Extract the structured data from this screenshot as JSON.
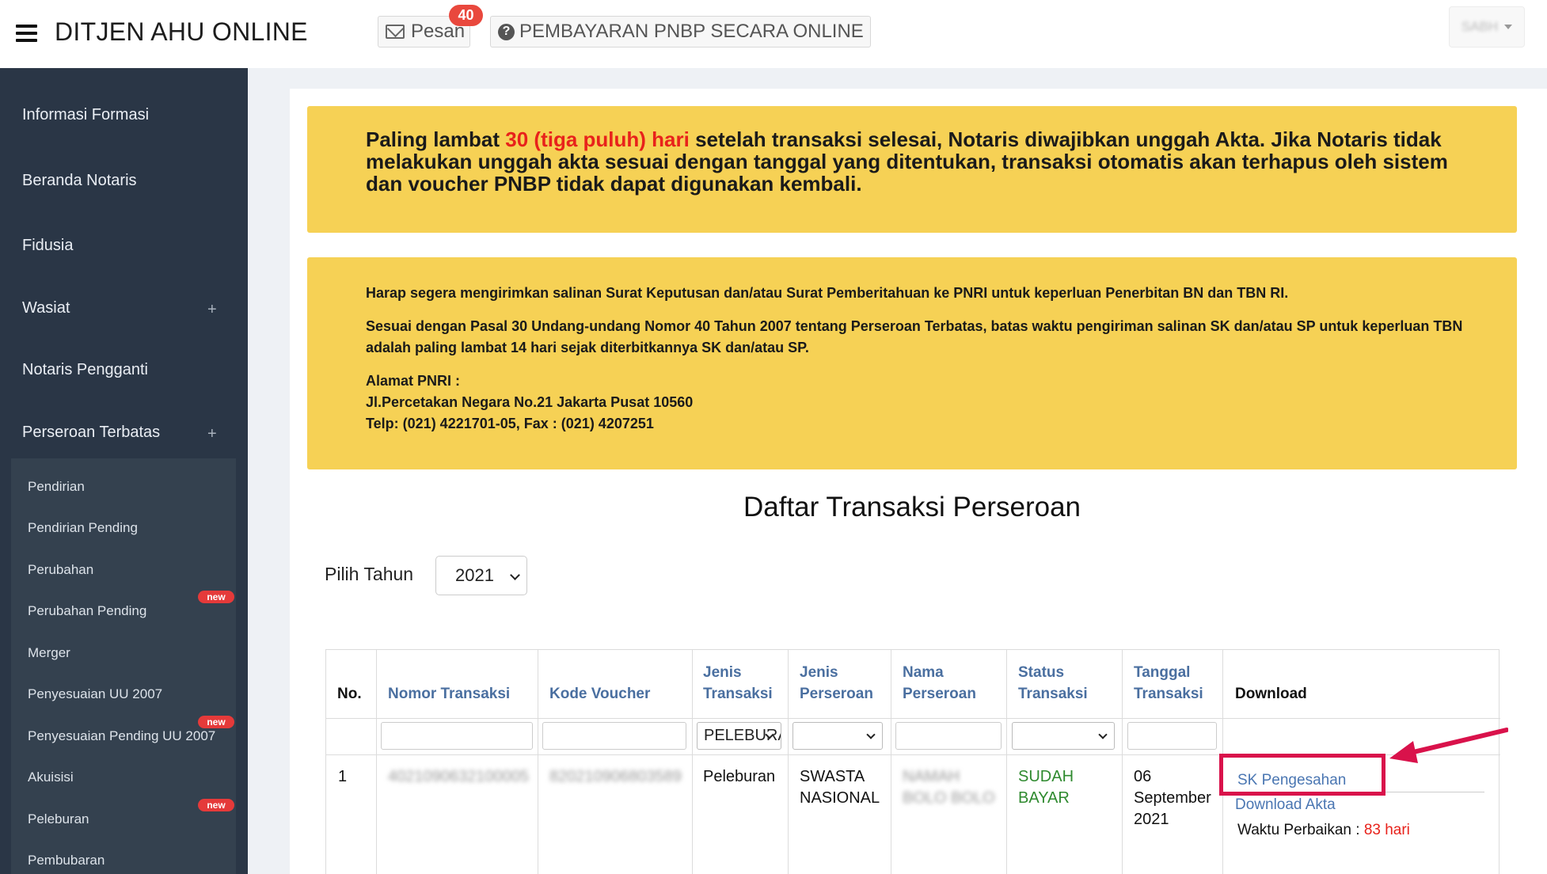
{
  "header": {
    "title": "DITJEN AHU ONLINE",
    "pesan_label": "Pesan",
    "pesan_count": "40",
    "pnbp_label": "PEMBAYARAN PNBP SECARA ONLINE",
    "user_label": "SABH"
  },
  "sidebar": {
    "items": [
      {
        "label": "Informasi Formasi"
      },
      {
        "label": "Beranda Notaris"
      },
      {
        "label": "Fidusia"
      },
      {
        "label": "Wasiat",
        "expand": "+"
      },
      {
        "label": "Notaris Pengganti"
      },
      {
        "label": "Perseroan Terbatas",
        "expand": "+"
      }
    ],
    "submenu": [
      {
        "label": "Pendirian"
      },
      {
        "label": "Pendirian Pending"
      },
      {
        "label": "Perubahan"
      },
      {
        "label": "Perubahan Pending",
        "badge": "new"
      },
      {
        "label": "Merger"
      },
      {
        "label": "Penyesuaian UU 2007"
      },
      {
        "label": "Penyesuaian Pending UU 2007",
        "badge": "new"
      },
      {
        "label": "Akuisisi"
      },
      {
        "label": "Peleburan",
        "badge": "new"
      },
      {
        "label": "Pembubaran"
      }
    ]
  },
  "notice1": {
    "part1": "Paling lambat ",
    "highlight": "30 (tiga puluh) hari",
    "part2": " setelah transaksi selesai, Notaris diwajibkan unggah Akta. Jika Notaris tidak melakukan unggah akta sesuai dengan tanggal yang ditentukan, transaksi otomatis akan terhapus oleh sistem dan voucher PNBP tidak dapat digunakan kembali."
  },
  "notice2": {
    "p1": "Harap segera mengirimkan salinan Surat Keputusan dan/atau Surat Pemberitahuan ke PNRI untuk keperluan Penerbitan BN dan TBN RI.",
    "p2": "Sesuai dengan Pasal 30 Undang-undang Nomor 40 Tahun 2007 tentang Perseroan Terbatas, batas waktu pengiriman salinan SK dan/atau SP untuk keperluan TBN adalah paling lambat 14 hari sejak diterbitkannya SK dan/atau SP.",
    "address_title": "Alamat PNRI :",
    "address_line": "Jl.Percetakan Negara No.21 Jakarta Pusat 10560",
    "phone_line": "Telp: (021) 4221701-05, Fax : (021) 4207251"
  },
  "page": {
    "title": "Daftar Transaksi Perseroan",
    "year_label": "Pilih Tahun",
    "year_value": "2021"
  },
  "table": {
    "headers": {
      "no": "No.",
      "nomor_transaksi": "Nomor Transaksi",
      "kode_voucher": "Kode Voucher",
      "jenis_transaksi_1": "Jenis",
      "jenis_transaksi_2": "Transaksi",
      "jenis_perseroan_1": "Jenis",
      "jenis_perseroan_2": "Perseroan",
      "nama_perseroan_1": "Nama",
      "nama_perseroan_2": "Perseroan",
      "status_transaksi_1": "Status",
      "status_transaksi_2": "Transaksi",
      "tanggal_transaksi_1": "Tanggal",
      "tanggal_transaksi_2": "Transaksi",
      "download": "Download"
    },
    "filters": {
      "jenis_transaksi_value": "PELEBURAN"
    },
    "row": {
      "no": "1",
      "nomor_transaksi": "4021090632100005",
      "kode_voucher": "820210906803589",
      "jenis_transaksi": "Peleburan",
      "jenis_perseroan_1": "SWASTA",
      "jenis_perseroan_2": "NASIONAL",
      "nama_perseroan_1": "NAMAH",
      "nama_perseroan_2": "BOLO BOLO",
      "status_1": "SUDAH",
      "status_2": "BAYAR",
      "tanggal_1": "06",
      "tanggal_2": "September",
      "tanggal_3": "2021",
      "sk_link": "SK Pengesahan",
      "download_akta": "Download Akta",
      "waktu_label": "Waktu Perbaikan : ",
      "waktu_value": "83 hari"
    }
  },
  "colors": {
    "sidebar_bg": "#2a3646",
    "notice_bg": "#f6d155",
    "link": "#4a76b2",
    "status_green": "#2f8a2f",
    "alert_red": "#e8221b",
    "highlight_box": "#d9124b"
  }
}
